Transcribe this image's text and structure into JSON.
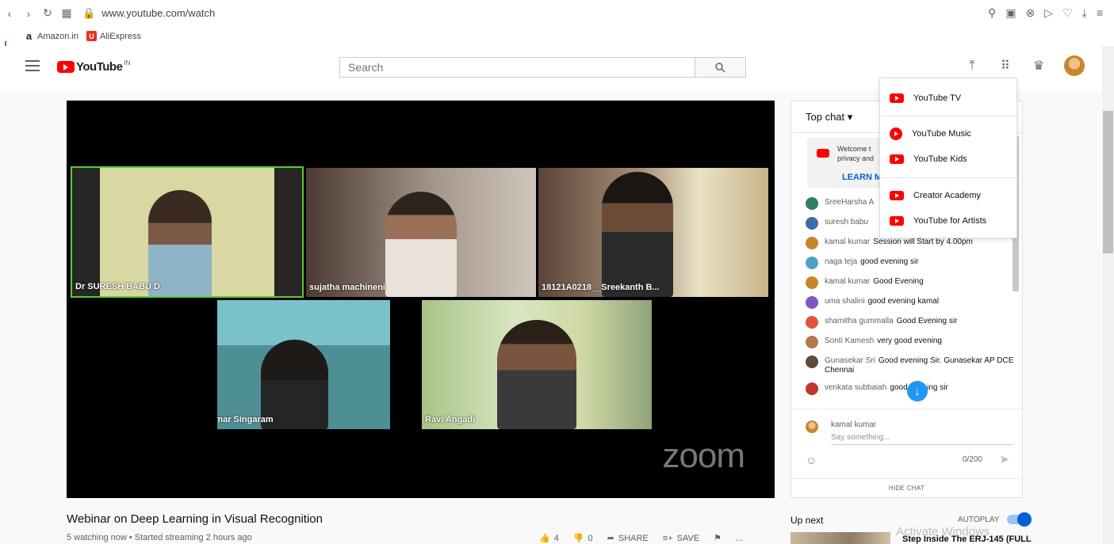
{
  "browser": {
    "url": "www.youtube.com/watch",
    "bookmarks": [
      {
        "label": "Amazon.in",
        "icon": "amazon-icon",
        "color": "#222222",
        "glyph": "a"
      },
      {
        "label": "AliExpress",
        "icon": "aliexpress-icon",
        "color": "#e43225",
        "glyph": "U"
      }
    ]
  },
  "header": {
    "logo_text": "YouTube",
    "region": "IN",
    "search_placeholder": "Search"
  },
  "video": {
    "title": "Webinar on Deep Learning in Visual Recognition",
    "meta": "5 watching now • Started streaming 2 hours ago",
    "overlay_brand": "zoom",
    "participants": [
      {
        "name": "Dr SURESH BABU D",
        "active": true
      },
      {
        "name": "sujatha machineni",
        "active": false
      },
      {
        "name": "18121A0218__Sreekanth B...",
        "active": false
      },
      {
        "name": "Jayakumar Singaram",
        "active": false
      },
      {
        "name": "Ravi Angadi",
        "active": false
      }
    ],
    "actions": {
      "likes": "4",
      "dislikes": "0",
      "share": "SHARE",
      "save": "SAVE",
      "more": "..."
    }
  },
  "chat": {
    "mode": "Top chat ▾",
    "welcome_text": [
      "Welcome t",
      "privacy and"
    ],
    "learn_more": "LEARN M",
    "messages": [
      {
        "author": "SreeHarsha A",
        "text": "",
        "color": "#2e7d6b"
      },
      {
        "author": "suresh babu",
        "text": "",
        "color": "#3b6ea8"
      },
      {
        "author": "kamal kumar",
        "text": "Session will Start by 4.00pm",
        "color": "#c8852c"
      },
      {
        "author": "naga teja",
        "text": "good evening sir",
        "color": "#4ba3c3"
      },
      {
        "author": "kamal kumar",
        "text": "Good Evening",
        "color": "#c8852c"
      },
      {
        "author": "uma shalini",
        "text": "good evening kamal",
        "color": "#7e57c2"
      },
      {
        "author": "shamitha gummalla",
        "text": "Good Evening sir",
        "color": "#e5533d"
      },
      {
        "author": "Sonti Kamesh",
        "text": "very good evening",
        "color": "#b07a4a"
      },
      {
        "author": "Gunasekar Sri",
        "text": "Good evening Sir. Gunasekar AP DCE Chennai",
        "color": "#5d4b3c"
      },
      {
        "author": "venkata subbaiah",
        "text": "good evening sir",
        "color": "#c0392b"
      }
    ],
    "composer": {
      "name": "kamal kumar",
      "placeholder": "Say something...",
      "count": "0/200"
    },
    "hide_chat": "HIDE CHAT"
  },
  "apps_menu": [
    {
      "label": "YouTube TV",
      "icon": "youtube-tv-icon"
    },
    {
      "label": "YouTube Music",
      "icon": "youtube-music-icon"
    },
    {
      "label": "YouTube Kids",
      "icon": "youtube-kids-icon"
    },
    {
      "label": "Creator Academy",
      "icon": "creator-academy-icon"
    },
    {
      "label": "YouTube for Artists",
      "icon": "youtube-artists-icon"
    }
  ],
  "upnext": {
    "label": "Up next",
    "autoplay": "AUTOPLAY",
    "first_title": "Step Inside The ERJ-145 (FULL"
  },
  "watermark": "Activate Windows",
  "colors": {
    "brand": "#ff0000",
    "accent": "#065fd4",
    "active_speaker": "#5ec932"
  }
}
